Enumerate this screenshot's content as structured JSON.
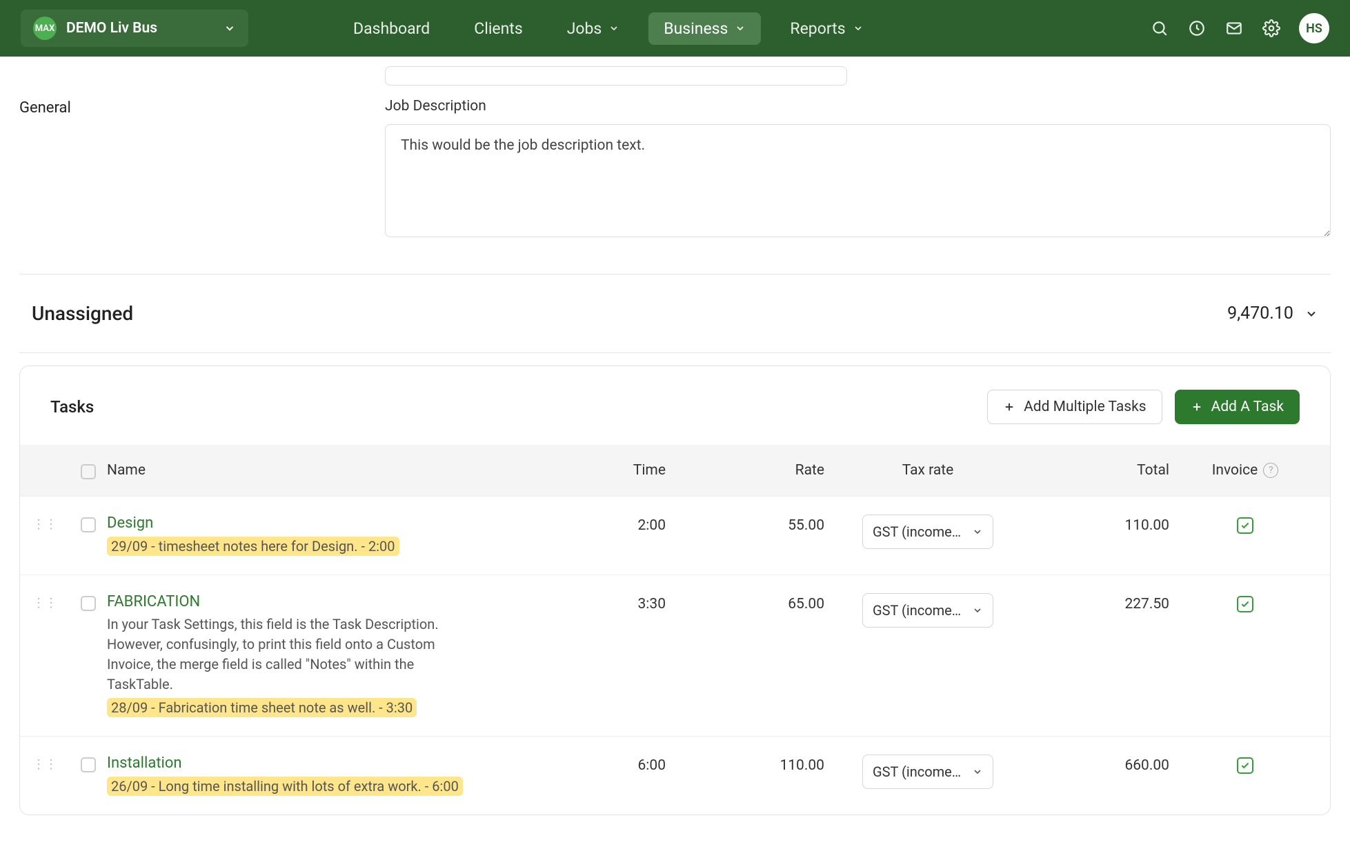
{
  "org": {
    "badge": "MAX",
    "name": "DEMO Liv Bus"
  },
  "nav": {
    "items": [
      {
        "label": "Dashboard",
        "chevron": false,
        "active": false
      },
      {
        "label": "Clients",
        "chevron": false,
        "active": false
      },
      {
        "label": "Jobs",
        "chevron": true,
        "active": false
      },
      {
        "label": "Business",
        "chevron": true,
        "active": true
      },
      {
        "label": "Reports",
        "chevron": true,
        "active": false
      }
    ]
  },
  "avatar": "HS",
  "sidebar_label": "General",
  "job": {
    "desc_label": "Job Description",
    "desc_value": "This would be the job description text."
  },
  "section": {
    "title": "Unassigned",
    "total": "9,470.10"
  },
  "tasks_card": {
    "title": "Tasks",
    "add_multiple": "Add Multiple Tasks",
    "add_one": "Add A Task",
    "columns": {
      "name": "Name",
      "time": "Time",
      "rate": "Rate",
      "tax": "Tax rate",
      "total": "Total",
      "invoice": "Invoice"
    },
    "rows": [
      {
        "name": "Design",
        "desc": "",
        "note": "29/09 - timesheet notes here for Design. - 2:00",
        "time": "2:00",
        "rate": "55.00",
        "tax": "GST (income…",
        "total": "110.00"
      },
      {
        "name": "FABRICATION",
        "desc": "In your Task Settings, this field is the Task Description. However, confusingly, to print this field onto a Custom Invoice, the merge field is called \"Notes\" within the TaskTable.",
        "note": "28/09 - Fabrication time sheet note as well. - 3:30",
        "time": "3:30",
        "rate": "65.00",
        "tax": "GST (income…",
        "total": "227.50"
      },
      {
        "name": "Installation",
        "desc": "",
        "note": "26/09 - Long time installing with lots of extra work. - 6:00",
        "time": "6:00",
        "rate": "110.00",
        "tax": "GST (income…",
        "total": "660.00"
      }
    ]
  },
  "help_glyph": "?"
}
